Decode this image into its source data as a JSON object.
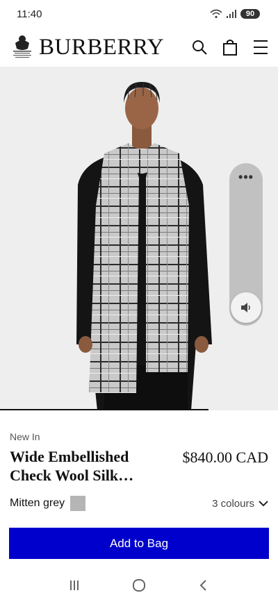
{
  "status_bar": {
    "time": "11:40",
    "battery": "90"
  },
  "header": {
    "brand": "BURBERRY"
  },
  "product": {
    "badge": "New In",
    "title": "Wide Embellished Check Wool Silk…",
    "price": "$840.00 CAD",
    "color_name": "Mitten grey",
    "swatch_color": "#b5b5b5",
    "colours_label": "3 colours"
  },
  "volume": {
    "more_label": "•••"
  },
  "cta": {
    "add_to_bag": "Add to Bag"
  },
  "accent_color": "#0000cc",
  "icons": [
    "wifi-icon",
    "signal-icon",
    "crest-logo",
    "search-icon",
    "bag-icon",
    "menu-icon",
    "more-icon",
    "speaker-icon",
    "chevron-down-icon",
    "recents-icon",
    "home-icon",
    "back-icon"
  ]
}
